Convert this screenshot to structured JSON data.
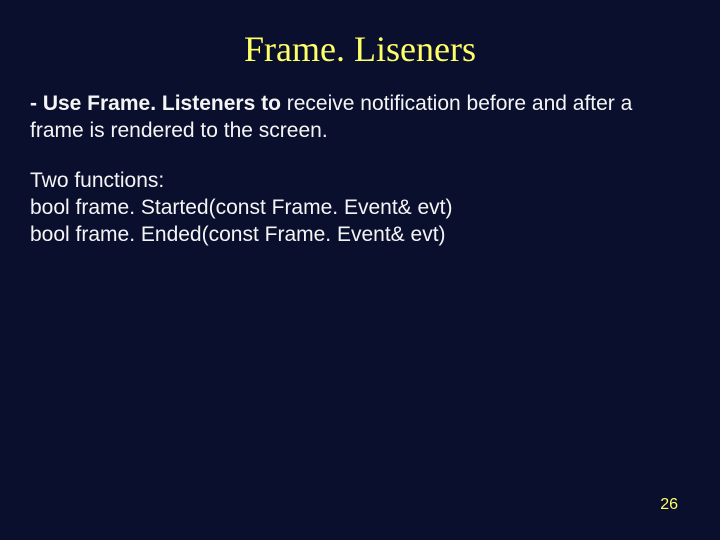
{
  "title": "Frame. Liseners",
  "body": {
    "para1_lead": "- Use Frame. Listeners to ",
    "para1_rest": "receive notification before and after a frame is rendered to the screen.",
    "para2_line1": "Two functions:",
    "para2_line2": "bool frame. Started(const Frame. Event& evt)",
    "para2_line3": "bool frame. Ended(const Frame. Event& evt)"
  },
  "page_number": "26"
}
